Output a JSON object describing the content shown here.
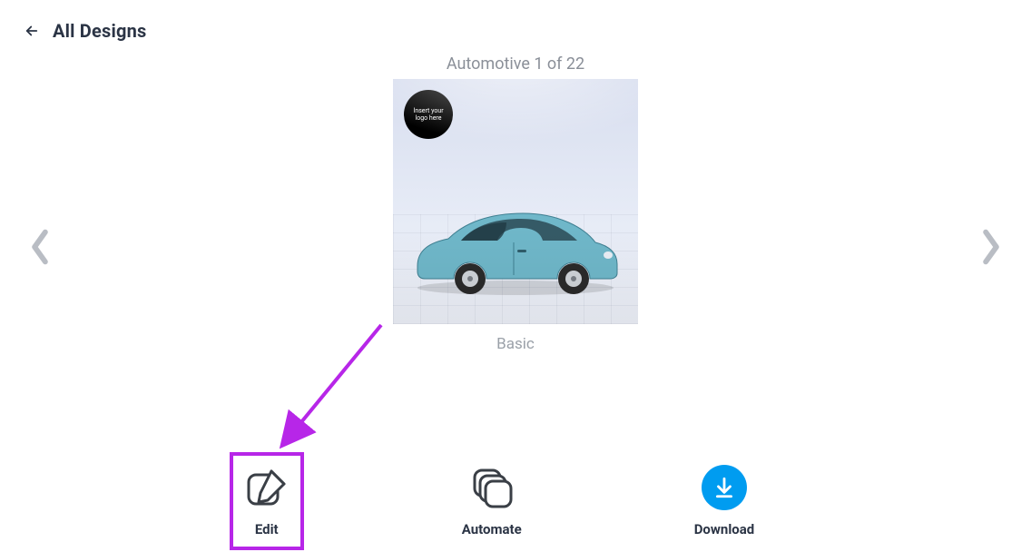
{
  "header": {
    "title": "All Designs"
  },
  "carousel": {
    "counter": "Automotive 1 of 22",
    "caption": "Basic",
    "logo_text": "Insert your logo here"
  },
  "actions": {
    "edit": "Edit",
    "automate": "Automate",
    "download": "Download"
  },
  "highlight": {
    "target": "edit"
  },
  "colors": {
    "accent_purple": "#b726e8",
    "download_blue": "#009cf0"
  }
}
